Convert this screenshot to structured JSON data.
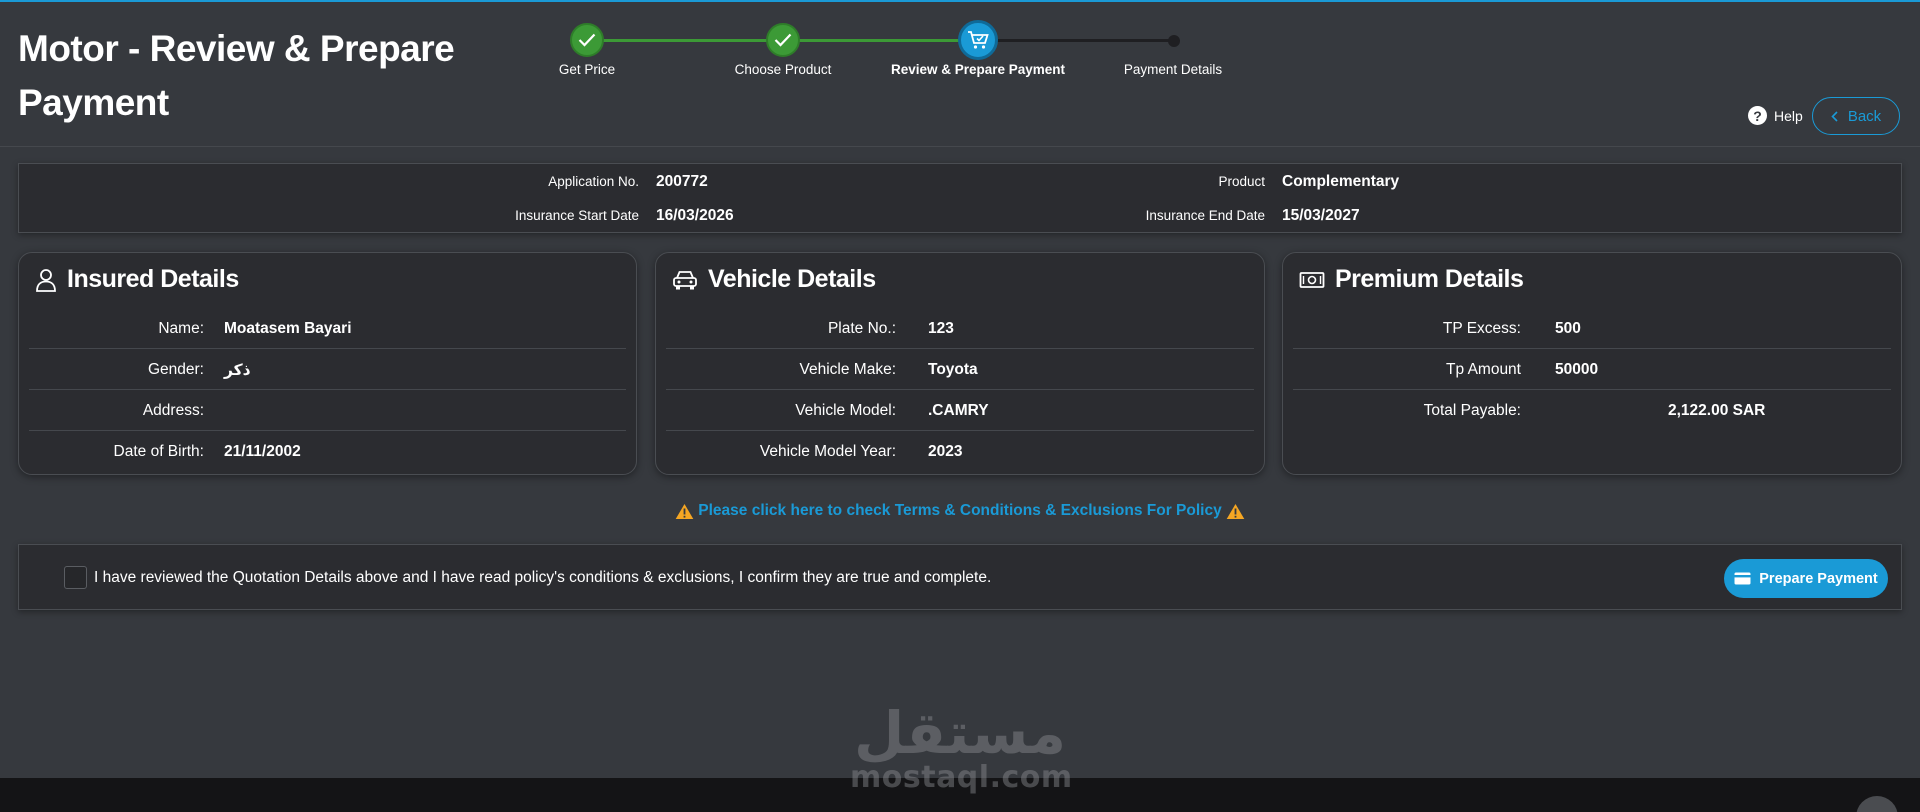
{
  "header": {
    "title": "Motor - Review & Prepare Payment",
    "help_label": "Help",
    "back_label": "Back"
  },
  "stepper": {
    "steps": [
      {
        "label": "Get Price",
        "status": "done"
      },
      {
        "label": "Choose Product",
        "status": "done"
      },
      {
        "label": "Review & Prepare Payment",
        "status": "active"
      },
      {
        "label": "Payment Details",
        "status": "pending"
      }
    ]
  },
  "application": {
    "application_no_label": "Application No.",
    "application_no": "200772",
    "product_label": "Product",
    "product": "Complementary",
    "start_date_label": "Insurance Start Date",
    "start_date": "16/03/2026",
    "end_date_label": "Insurance End Date",
    "end_date": "15/03/2027"
  },
  "insured": {
    "title": "Insured Details",
    "icon": "user-icon",
    "rows": [
      {
        "label": "Name:",
        "value": "Moatasem Bayari"
      },
      {
        "label": "Gender:",
        "value": "ذكر"
      },
      {
        "label": "Address:",
        "value": ""
      },
      {
        "label": "Date of Birth:",
        "value": "21/11/2002"
      }
    ]
  },
  "vehicle": {
    "title": "Vehicle Details",
    "icon": "car-icon",
    "rows": [
      {
        "label": "Plate No.:",
        "value": "123"
      },
      {
        "label": "Vehicle Make:",
        "value": "Toyota"
      },
      {
        "label": "Vehicle Model:",
        "value": ".CAMRY"
      },
      {
        "label": "Vehicle Model Year:",
        "value": "2023"
      }
    ]
  },
  "premium": {
    "title": "Premium Details",
    "icon": "money-icon",
    "rows": [
      {
        "label": "TP Excess:",
        "value": "500"
      },
      {
        "label": "Tp Amount",
        "value": "50000"
      },
      {
        "label": "Total Payable:",
        "value": "2,122.00 SAR"
      }
    ]
  },
  "terms": {
    "link_text": "Please click here to check Terms & Conditions & Exclusions For Policy"
  },
  "confirm": {
    "text": "I have reviewed the Quotation Details above and I have read policy's conditions & exclusions, I confirm they are true and complete.",
    "checked": false,
    "button_label": "Prepare Payment"
  },
  "watermark": {
    "arabic": "مستقل",
    "latin": "mostaql.com"
  },
  "colors": {
    "accent": "#1a9ad6",
    "success": "#3c9a36",
    "background": "#36393e",
    "panel": "#2b2c30",
    "warning": "#f5a623"
  }
}
